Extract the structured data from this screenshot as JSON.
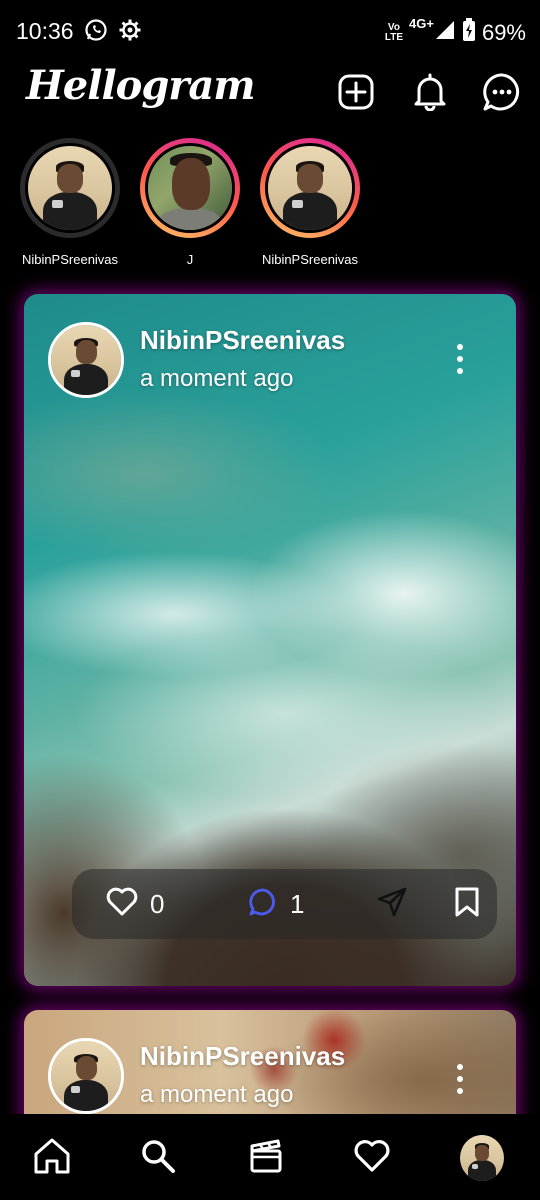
{
  "status_bar": {
    "time": "10:36",
    "network_label_top": "Vo",
    "network_label_bottom": "LTE",
    "network_type": "4G+",
    "battery": "69%",
    "icons": [
      "whatsapp-icon",
      "settings-icon",
      "volte-icon",
      "signal-icon",
      "battery-icon"
    ]
  },
  "app_bar": {
    "title": "Hellogram",
    "icons": [
      "add-post-icon",
      "notifications-bell-icon",
      "messages-icon"
    ]
  },
  "stories": [
    {
      "name": "NibinPSreenivas",
      "ring": "none"
    },
    {
      "name": "J",
      "ring": "gradient"
    },
    {
      "name": "NibinPSreenivas",
      "ring": "gradient"
    }
  ],
  "posts": [
    {
      "author": "NibinPSreenivas",
      "time": "a moment ago",
      "likes": "0",
      "comments": "1"
    },
    {
      "author": "NibinPSreenivas",
      "time": "a moment ago"
    }
  ],
  "bottom_nav": {
    "items": [
      "home-icon",
      "search-icon",
      "reels-icon",
      "activity-heart-icon",
      "profile-avatar"
    ]
  },
  "colors": {
    "background": "#000000",
    "card_glow": "#be00be",
    "comment_icon": "#4b5cf0",
    "story_ring_gradient": [
      "#d6249f",
      "#fd5949",
      "#fdc468"
    ]
  }
}
